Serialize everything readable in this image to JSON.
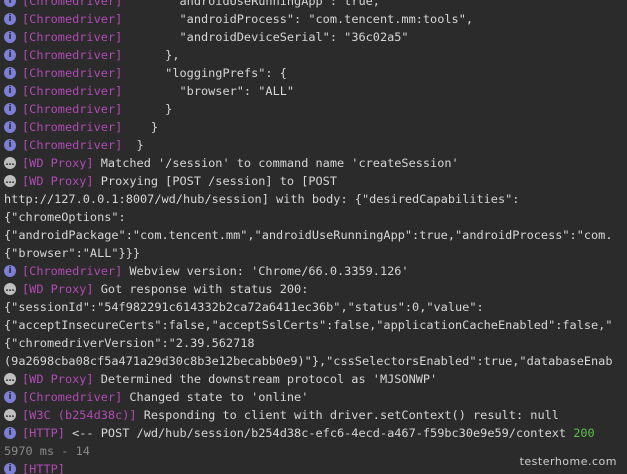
{
  "icons": {
    "info_glyph": "i",
    "message_glyph": "…",
    "info_color": "#7b7fd6",
    "tag_color": "#b04bb3",
    "status_ok_color": "#5fbf4c"
  },
  "log": [
    {
      "icon": "info",
      "tag": "[Chromedriver]",
      "text": "        androidUseRunningApp : true,"
    },
    {
      "icon": "info",
      "tag": "[Chromedriver]",
      "text": "        \"androidProcess\": \"com.tencent.mm:tools\","
    },
    {
      "icon": "info",
      "tag": "[Chromedriver]",
      "text": "        \"androidDeviceSerial\": \"36c02a5\""
    },
    {
      "icon": "info",
      "tag": "[Chromedriver]",
      "text": "      },"
    },
    {
      "icon": "info",
      "tag": "[Chromedriver]",
      "text": "      \"loggingPrefs\": {"
    },
    {
      "icon": "info",
      "tag": "[Chromedriver]",
      "text": "        \"browser\": \"ALL\""
    },
    {
      "icon": "info",
      "tag": "[Chromedriver]",
      "text": "      }"
    },
    {
      "icon": "info",
      "tag": "[Chromedriver]",
      "text": "    }"
    },
    {
      "icon": "info",
      "tag": "[Chromedriver]",
      "text": "  }"
    },
    {
      "icon": "msg",
      "tag": "[WD Proxy]",
      "text": " Matched '/session' to command name 'createSession'"
    },
    {
      "icon": "msg",
      "tag": "[WD Proxy]",
      "text": " Proxying [POST /session] to [POST"
    },
    {
      "icon": "none",
      "tag": "",
      "text": "http://127.0.0.1:8007/wd/hub/session] with body: {\"desiredCapabilities\":"
    },
    {
      "icon": "none",
      "tag": "",
      "text": "{\"chromeOptions\":"
    },
    {
      "icon": "none",
      "tag": "",
      "text": "{\"androidPackage\":\"com.tencent.mm\",\"androidUseRunningApp\":true,\"androidProcess\":\"com."
    },
    {
      "icon": "none",
      "tag": "",
      "text": "{\"browser\":\"ALL\"}}}"
    },
    {
      "icon": "info",
      "tag": "[Chromedriver]",
      "text": " Webview version: 'Chrome/66.0.3359.126'"
    },
    {
      "icon": "msg",
      "tag": "[WD Proxy]",
      "text": " Got response with status 200:"
    },
    {
      "icon": "none",
      "tag": "",
      "text": "{\"sessionId\":\"54f982291c614332b2ca72a6411ec36b\",\"status\":0,\"value\":"
    },
    {
      "icon": "none",
      "tag": "",
      "text": "{\"acceptInsecureCerts\":false,\"acceptSslCerts\":false,\"applicationCacheEnabled\":false,\""
    },
    {
      "icon": "none",
      "tag": "",
      "text": "{\"chromedriverVersion\":\"2.39.562718"
    },
    {
      "icon": "none",
      "tag": "",
      "text": "(9a2698cba08cf5a471a29d30c8b3e12becabb0e9)\"},\"cssSelectorsEnabled\":true,\"databaseEnab"
    },
    {
      "icon": "msg",
      "tag": "[WD Proxy]",
      "text": " Determined the downstream protocol as 'MJSONWP'"
    },
    {
      "icon": "info",
      "tag": "[Chromedriver]",
      "text": " Changed state to 'online'"
    },
    {
      "icon": "msg",
      "tag": "[W3C (b254d38c)]",
      "text": " Responding to client with driver.setContext() result: null"
    },
    {
      "icon": "info",
      "tag": "[HTTP]",
      "text": " <-- POST /wd/hub/session/b254d38c-efc6-4ecd-a467-f59bc30e9e59/context ",
      "status": "200"
    },
    {
      "icon": "none",
      "tag": "",
      "text": "5970 ms - 14",
      "dim": true
    },
    {
      "icon": "info",
      "tag": "[HTTP]",
      "text": "",
      "cut": true
    }
  ],
  "watermark": "testerhome.com"
}
